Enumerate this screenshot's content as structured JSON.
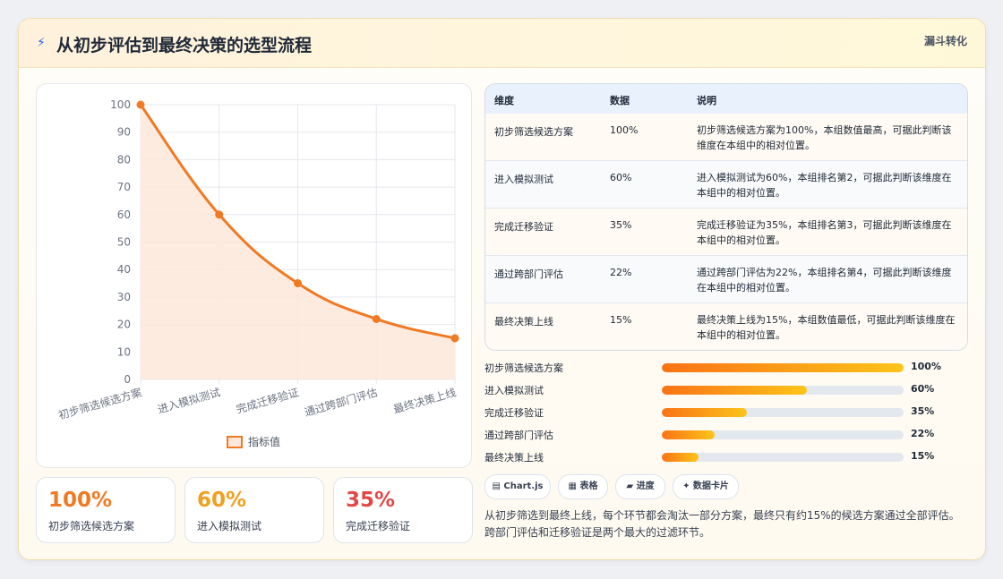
{
  "header": {
    "icon": "bolt-icon",
    "title": "从初步评估到最终决策的选型流程",
    "tag": "漏斗转化"
  },
  "chart_data": {
    "type": "line",
    "categories": [
      "初步筛选候选方案",
      "进入模拟测试",
      "完成迁移验证",
      "通过跨部门评估",
      "最终决策上线"
    ],
    "series": [
      {
        "name": "指标值",
        "values": [
          100,
          60,
          35,
          22,
          15
        ]
      }
    ],
    "ylim": [
      0,
      100
    ],
    "yticks": [
      0,
      10,
      20,
      30,
      40,
      50,
      60,
      70,
      80,
      90,
      100
    ],
    "grid": true,
    "legend": "bottom",
    "fill": "area",
    "colors": {
      "line": "#f07a23",
      "fill": "#fde8da"
    }
  },
  "kpis": [
    {
      "value": "100%",
      "label": "初步筛选候选方案",
      "color": "#f07a23"
    },
    {
      "value": "60%",
      "label": "进入模拟测试",
      "color": "#f0a020"
    },
    {
      "value": "35%",
      "label": "完成迁移验证",
      "color": "#e04848"
    }
  ],
  "table": {
    "headers": [
      "维度",
      "数据",
      "说明"
    ],
    "rows": [
      {
        "dim": "初步筛选候选方案",
        "val": "100%",
        "desc": "初步筛选候选方案为100%，本组数值最高，可据此判断该维度在本组中的相对位置。"
      },
      {
        "dim": "进入模拟测试",
        "val": "60%",
        "desc": "进入模拟测试为60%，本组排名第2，可据此判断该维度在本组中的相对位置。"
      },
      {
        "dim": "完成迁移验证",
        "val": "35%",
        "desc": "完成迁移验证为35%，本组排名第3，可据此判断该维度在本组中的相对位置。"
      },
      {
        "dim": "通过跨部门评估",
        "val": "22%",
        "desc": "通过跨部门评估为22%，本组排名第4，可据此判断该维度在本组中的相对位置。"
      },
      {
        "dim": "最终决策上线",
        "val": "15%",
        "desc": "最终决策上线为15%，本组数值最低，可据此判断该维度在本组中的相对位置。"
      }
    ]
  },
  "progress": [
    {
      "label": "初步筛选候选方案",
      "value": "100%",
      "fraction": 1.0
    },
    {
      "label": "进入模拟测试",
      "value": "60%",
      "fraction": 0.6
    },
    {
      "label": "完成迁移验证",
      "value": "35%",
      "fraction": 0.35
    },
    {
      "label": "通过跨部门评估",
      "value": "22%",
      "fraction": 0.22
    },
    {
      "label": "最终决策上线",
      "value": "15%",
      "fraction": 0.15
    }
  ],
  "chips": [
    {
      "label": "▤ Chart.js"
    },
    {
      "label": "▦ 表格"
    },
    {
      "label": "▰ 进度"
    },
    {
      "label": "✦ 数据卡片"
    }
  ],
  "summary": "从初步筛选到最终上线，每个环节都会淘汰一部分方案，最终只有约15%的候选方案通过全部评估。跨部门评估和迁移验证是两个最大的过滤环节。"
}
